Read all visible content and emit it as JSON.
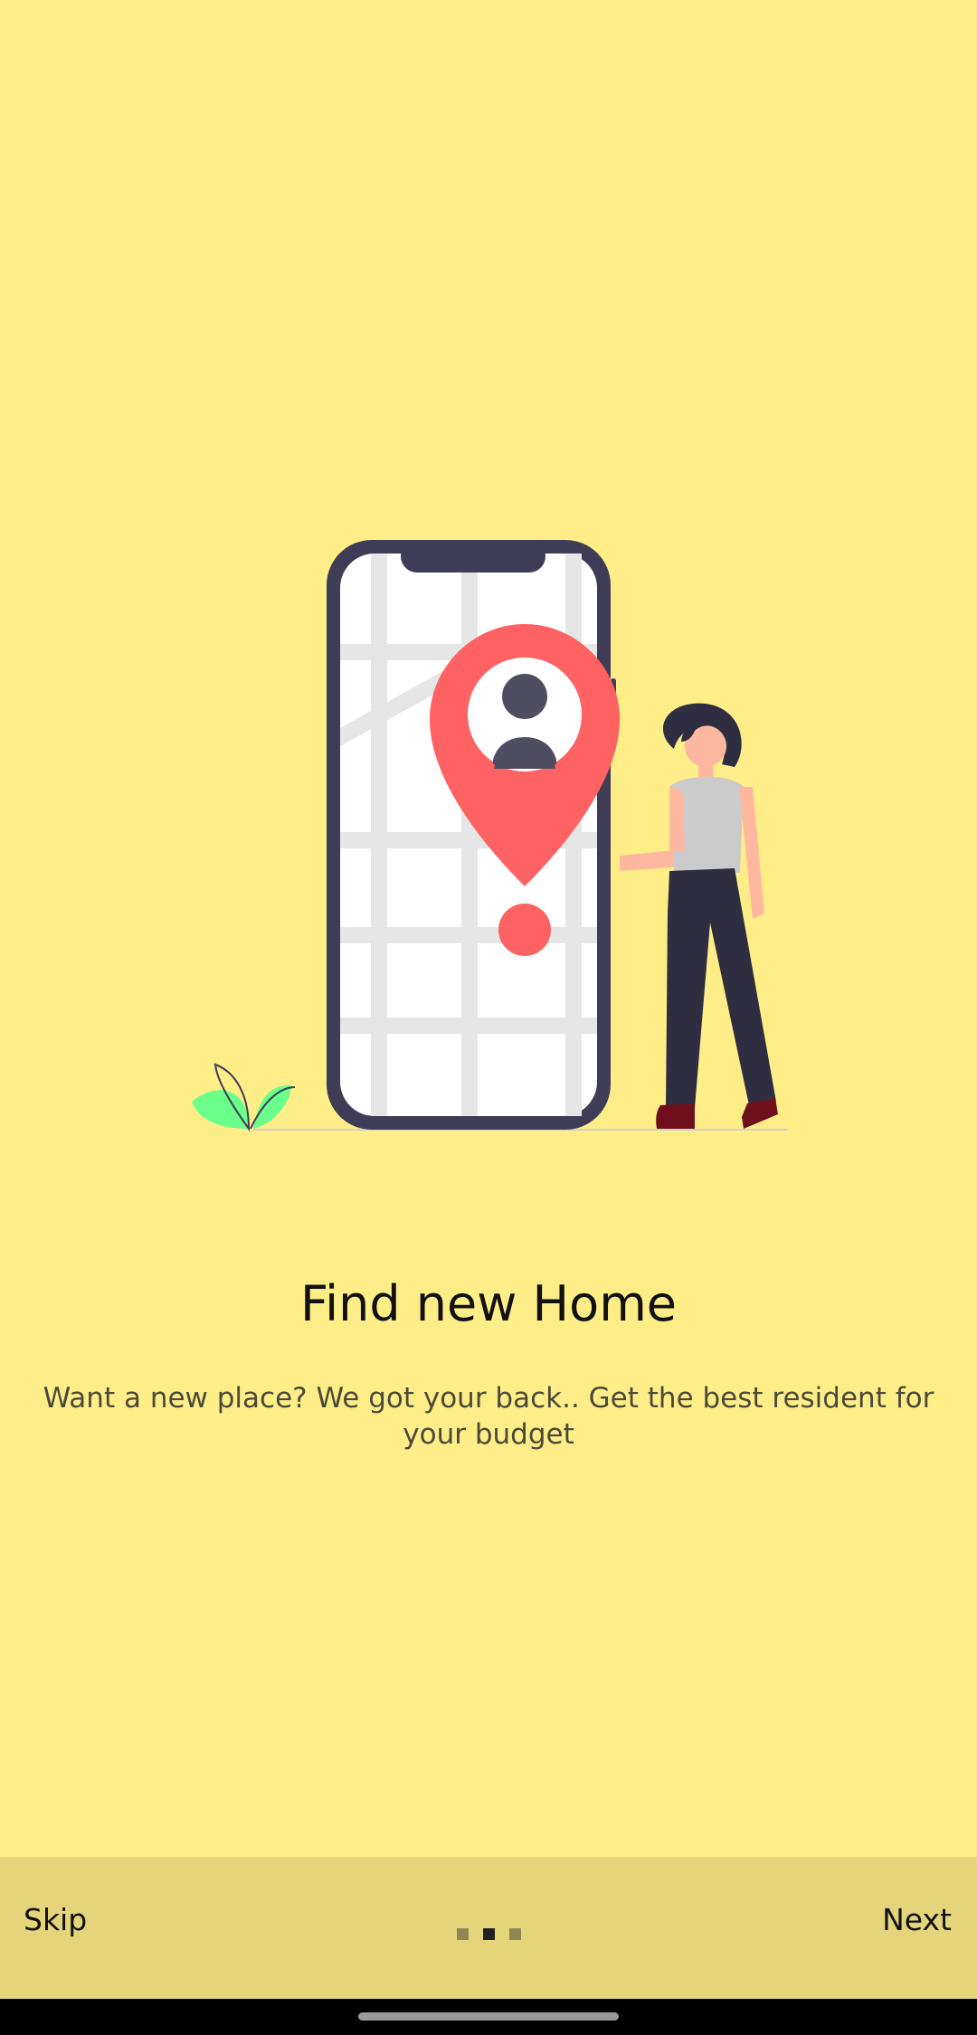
{
  "onboarding": {
    "title": "Find new Home",
    "description": "Want a new place? We got your back.. Get the best resident for your budget"
  },
  "footer": {
    "skip_label": "Skip",
    "next_label": "Next",
    "page_indicator": {
      "total": 3,
      "current": 2
    }
  },
  "colors": {
    "background": "#FFEE88",
    "footer_background": "#E4D57A",
    "accent_pin": "#FF6262",
    "phone_frame": "#3F3D56"
  },
  "illustration": {
    "icons": [
      "smartphone-map-icon",
      "location-pin-icon",
      "user-avatar-icon",
      "woman-figure-icon",
      "plant-icon"
    ]
  }
}
